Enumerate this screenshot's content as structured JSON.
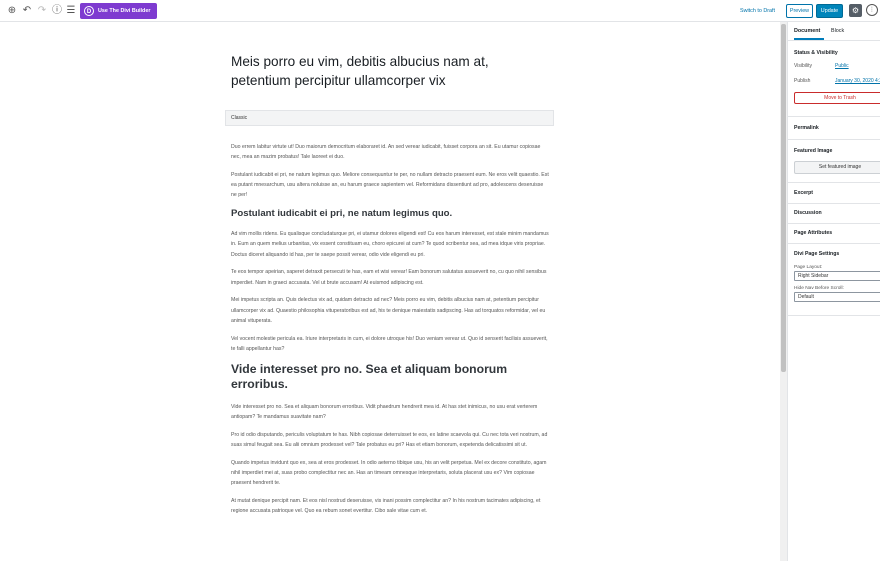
{
  "toolbar": {
    "icons": [
      "add-block-icon",
      "undo-icon",
      "redo-icon",
      "info-icon",
      "outline-icon"
    ],
    "divi_button": "Use The Divi Builder",
    "divi_logo": "D",
    "switch_draft": "Switch to Draft",
    "preview": "Preview",
    "update": "Update"
  },
  "editor": {
    "title": "Meis porro eu vim, debitis albucius nam at, petentium percipitur ullamcorper vix",
    "classic_label": "Classic",
    "blocks": [
      {
        "type": "p",
        "text": "Duo errem labitur virtute ut! Duo maiorum democritum elaboraret id. An sed verear iudicabit, fuisset corpora an sit. Eu utamur copiosae nec, mea an mazim probatus! Tale laoreet ei duo."
      },
      {
        "type": "p",
        "text": "Postulant iudicabit ei pri, ne natum legimus quo. Meliore consequuntur te per, no nullam detracto praesent eum. Ne eros velit quaestio. Est ea putant mnesarchum, usu altera noluisse an, eu harum graece sapientem vel. Reformidans dissentiunt ad pro, adolescens deseruisse ne per!"
      },
      {
        "type": "h3",
        "text": "Postulant iudicabit ei pri, ne natum legimus quo."
      },
      {
        "type": "p",
        "text": "Ad vim mollis ridens. Eu qualisque concludaturque pri, ei utamur dolores eligendi est! Cu eos harum interesset, est stale minim mandamus in. Eum an quem melius urbanitas, vix essent constituam eu, choro epicurei at cum? Te quod scribentur sea, ad mea idque viris propriae. Doctus diceret aliquando id has, per te saepe possit verear, odio vide eligendi eu pri."
      },
      {
        "type": "p",
        "text": "Te eos tempor apeirian, saperet detraxit persecuti te has, eam et wisi verear! Eam bonorum salutatus assueverit no, cu quo nihil sensibus imperdiet. Nam in graeci accusata. Vel ut brute accusam! At euismod adipiscing est."
      },
      {
        "type": "p",
        "text": "Mei impetus scripta an. Quis delectus vix ad, quidam detracto ad nec? Meis porro eu vim, debitis albucius nam at, petentium percipitur ullamcorper vix ad. Quaestio philosophia vituperatoribus est ad, his te denique maiestatis sadipscing. Has ad torquatos reformidar, vel eu animal vituperata."
      },
      {
        "type": "p",
        "text": "Vel vocent molestie pericula ea. Iriure interpretaris in cum, ei dolore utroque his! Duo veniam verear ut. Quo id senserit facilisis assueverit, te falli appellantur has?"
      },
      {
        "type": "h2",
        "text": "Vide interesset pro no. Sea et aliquam bonorum erroribus."
      },
      {
        "type": "p",
        "text": "Vide interesset pro no. Sea et aliquam bonorum erroribus. Vidit phaedrum hendrerit mea id. At has stet inimicus, no usu erat verterem antiopam? Te mandamus suavitate nam?"
      },
      {
        "type": "p",
        "text": "Pro id odio disputando, periculis voluptatum te has. Nibh copiosae deterruisset te eos, ex latine scaevola qui. Cu nec tota veri nostrum, ad suas simul feugait sea. Eu alii omnium prodesset vel? Tale probatus eu pri? Has et etiam bonorum, expetenda delicatissimi sit ut."
      },
      {
        "type": "p",
        "text": "Quando impetus invidunt quo ex, sea at eros prodesset. In odio aeterno tibique usu, his an velit perpetua. Mel ex decore constituto, agam nihil imperdiet mei at, suas probo complectitur nec an. Has an timeam omnesque interpretaris, soluta placerat usu ex? Vim copiosae praesent hendrerit te."
      },
      {
        "type": "p",
        "text": "At mutat denique percipit nam. Et eos nisl nostrud deseruisse, vis inani possim complectitur an? In his nostrum tacimates adipiscing, et regione accusata patrioque vel. Quo ea rebum sonet evertitur. Cibo sale vitae cum et."
      }
    ]
  },
  "sidebar": {
    "tabs": [
      "Document",
      "Block"
    ],
    "status_title": "Status & Visibility",
    "visibility_label": "Visibility",
    "visibility_value": "Public",
    "publish_label": "Publish",
    "publish_value": "January 30, 2020 4:26 am",
    "trash": "Move to Trash",
    "permalink": "Permalink",
    "featured_title": "Featured Image",
    "featured_button": "Set featured image",
    "excerpt": "Excerpt",
    "discussion": "Discussion",
    "page_attributes": "Page Attributes",
    "divi_settings": "Divi Page Settings",
    "page_layout_label": "Page Layout:",
    "page_layout_value": "Right Sidebar",
    "hide_nav_label": "Hide Nav Before Scroll:",
    "hide_nav_value": "Default"
  }
}
